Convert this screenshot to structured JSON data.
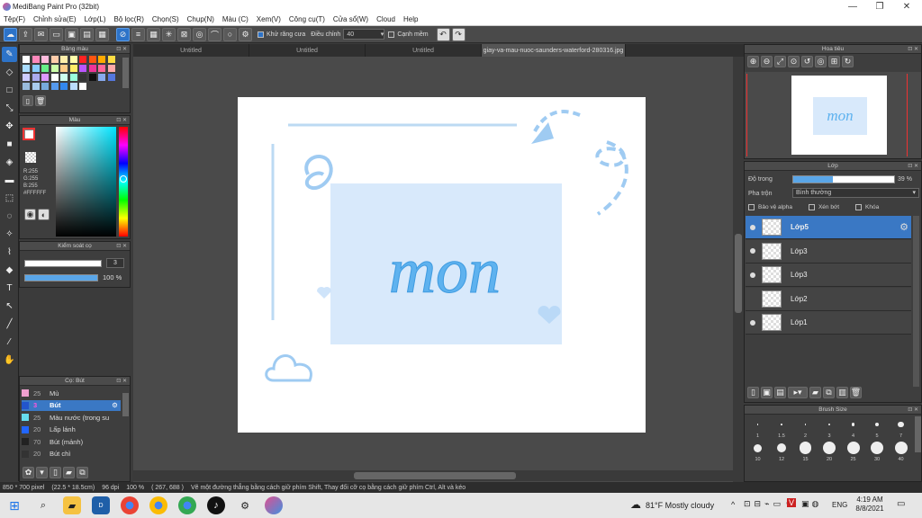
{
  "window": {
    "title": "MediBang Paint Pro (32bit)",
    "minimize": "—",
    "maximize": "❐",
    "close": "✕"
  },
  "menu": [
    "Tệp(F)",
    "Chỉnh sửa(E)",
    "Lớp(L)",
    "Bộ lọc(R)",
    "Chọn(S)",
    "Chụp(N)",
    "Màu (C)",
    "Xem(V)",
    "Công cụ(T)",
    "Cửa sổ(W)",
    "Cloud",
    "Help"
  ],
  "toolbar": {
    "antialias_label": "Khử răng cưa",
    "correction_label": "Điều chỉnh",
    "correction_value": "40",
    "edge_label": "Cạnh mềm"
  },
  "panels": {
    "palette_title": "Bảng màu",
    "color_title": "Màu",
    "color_r": "R:255",
    "color_g": "G:255",
    "color_b": "B:255",
    "color_hex": "#FFFFFF",
    "brush_control_title": "Kiểm soát cọ",
    "brush_size_value": "3",
    "brush_opacity_value": "100 %",
    "brush_list_title": "Cọ: Bút",
    "navigator_title": "Hoa tiêu",
    "layer_title": "Lớp",
    "opacity_label": "Độ trong",
    "opacity_value": "39 %",
    "blend_label": "Pha trộn",
    "blend_value": "Bình thường",
    "protect_alpha": "Bảo vệ alpha",
    "clipping": "Xén bớt",
    "lock": "Khóa",
    "brush_size_title": "Brush Size"
  },
  "tabs": [
    {
      "label": "Untitled",
      "active": false
    },
    {
      "label": "Untitled",
      "active": false
    },
    {
      "label": "Untitled",
      "active": false
    },
    {
      "label": "giay-va-mau-nuoc-saunders-waterford-280316.jpg",
      "active": true
    }
  ],
  "artwork_text": "mon",
  "brushes": [
    {
      "size": "25",
      "name": "Mù",
      "color": "#f0a0d0"
    },
    {
      "size": "3",
      "name": "Bút",
      "color": "#2255cc",
      "selected": true
    },
    {
      "size": "25",
      "name": "Màu nước (trong su",
      "color": "#66ddee"
    },
    {
      "size": "20",
      "name": "Lấp lánh",
      "color": "#2266ff"
    },
    {
      "size": "70",
      "name": "Bút (mảnh)",
      "color": "#222222"
    },
    {
      "size": "20",
      "name": "Bút chì",
      "color": "#333333"
    }
  ],
  "layers": [
    {
      "name": "Lớp5",
      "visible": true,
      "selected": true
    },
    {
      "name": "Lớp3",
      "visible": true,
      "selected": false
    },
    {
      "name": "Lớp3",
      "visible": true,
      "selected": false
    },
    {
      "name": "Lớp2",
      "visible": false,
      "selected": false
    },
    {
      "name": "Lớp1",
      "visible": true,
      "selected": false
    }
  ],
  "brush_sizes": [
    "1",
    "1.5",
    "2",
    "3",
    "4",
    "5",
    "7",
    "10",
    "12",
    "15",
    "20",
    "25",
    "30",
    "40"
  ],
  "status": {
    "size": "850 * 700 pixel",
    "cm": "(22.5 * 18.5cm)",
    "dpi": "96 dpi",
    "zoom": "100 %",
    "coords": "( 267, 688 )",
    "hint": "Vẽ một đường thẳng bằng cách giữ phím Shift, Thay đổi cỡ cọ bằng cách giữ phím Ctrl, Alt và kéo"
  },
  "taskbar": {
    "weather": "81°F  Mostly cloudy",
    "lang": "ENG",
    "time": "4:19 AM",
    "date": "8/8/2021"
  }
}
